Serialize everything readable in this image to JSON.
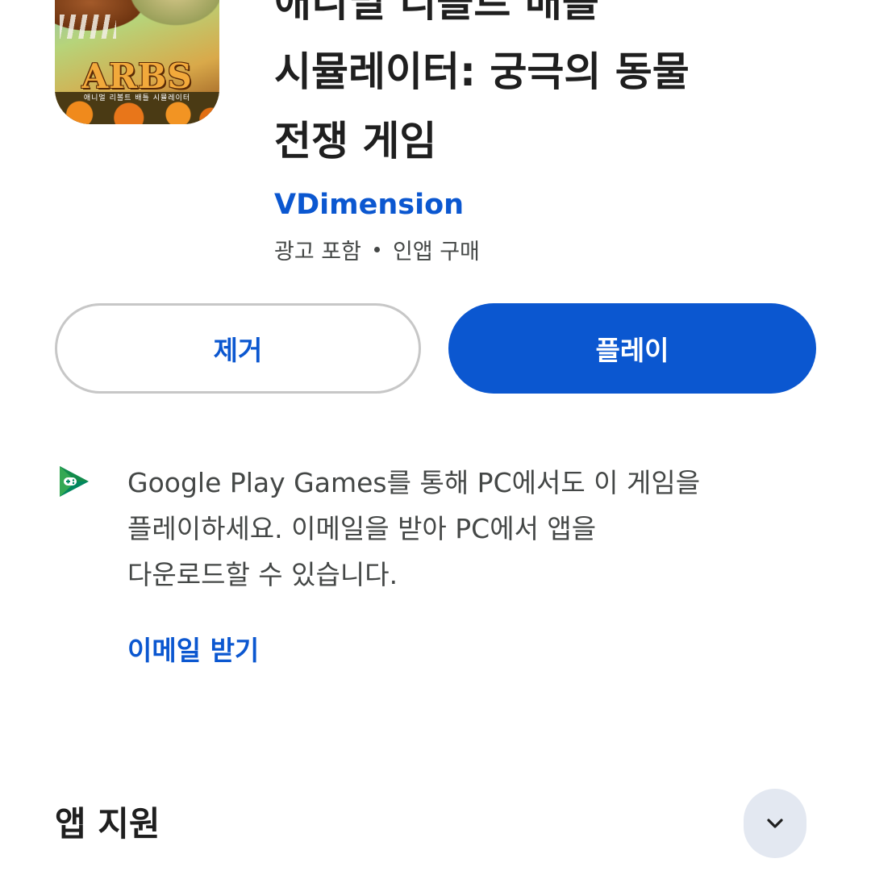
{
  "app": {
    "icon_logo": "ARBS",
    "icon_subtitle": "애니멀 리볼트 배틀 시뮬레이터",
    "title_lines": [
      "애니멀 리볼트 배틀",
      "시뮬레이터: 궁극의 동물",
      "전쟁 게임"
    ],
    "developer": "VDimension",
    "meta": [
      "광고 포함",
      "인앱 구매"
    ]
  },
  "actions": {
    "uninstall_label": "제거",
    "play_label": "플레이"
  },
  "pc_promo": {
    "icon": "google-play-games-icon",
    "lines": [
      "Google Play Games를 통해 PC에서도 이 게임을",
      "플레이하세요. 이메일을 받아 PC에서 앱을",
      "다운로드할 수 있습니다."
    ],
    "link_label": "이메일 받기"
  },
  "support": {
    "title": "앱 지원",
    "expand_icon": "chevron-down-icon"
  },
  "colors": {
    "accent": "#0b57d0",
    "text_primary": "#1f1f1f",
    "text_secondary": "#444746",
    "outline": "#c7c7c7",
    "chip_bg": "#e3e8f1",
    "play_games_green": "#01875f"
  }
}
